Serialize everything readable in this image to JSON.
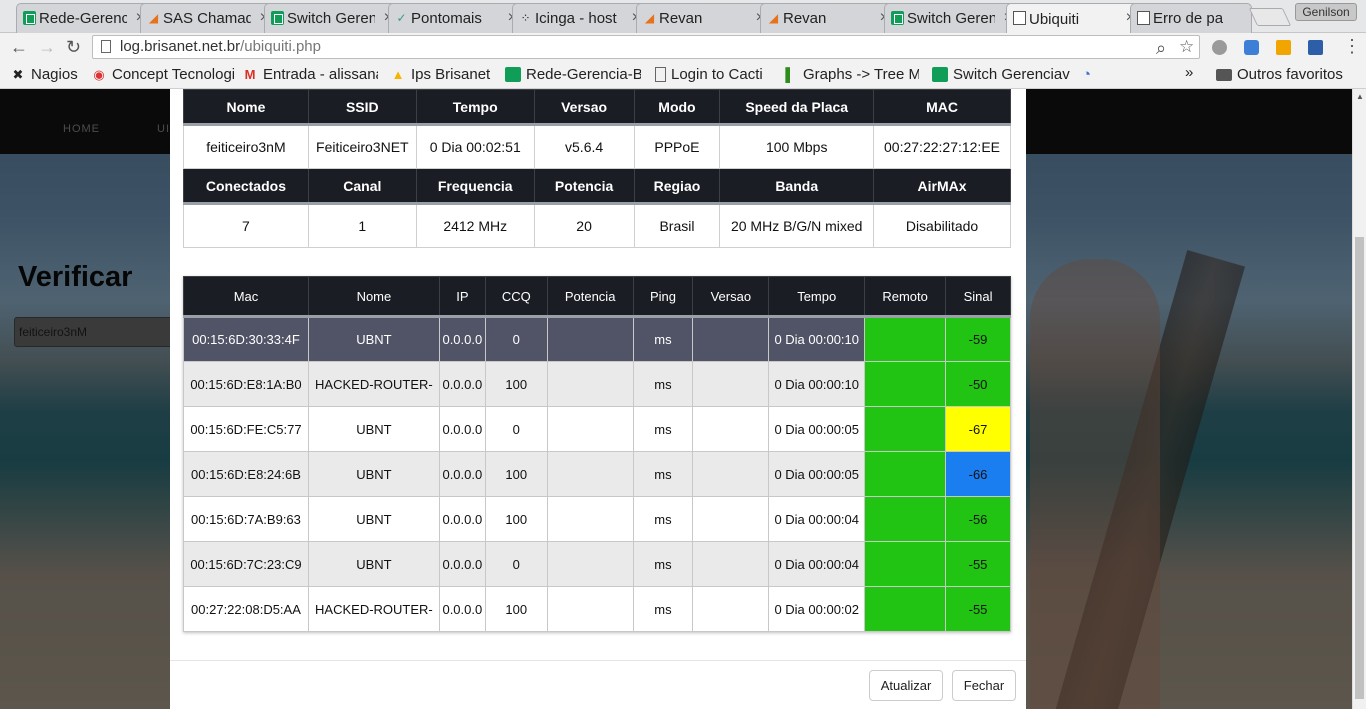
{
  "browser": {
    "tabs": [
      {
        "title": "Rede-Gerencia",
        "icon": "sheet-icon"
      },
      {
        "title": "SAS Chamados",
        "icon": "flame-icon"
      },
      {
        "title": "Switch Gerencia",
        "icon": "sheet-icon"
      },
      {
        "title": "Pontomais",
        "icon": "check-icon"
      },
      {
        "title": "Icinga - host",
        "icon": "icinga-icon"
      },
      {
        "title": "Revan",
        "icon": "flame-icon"
      },
      {
        "title": "Revan",
        "icon": "flame-icon"
      },
      {
        "title": "Switch Gerencia",
        "icon": "sheet-icon"
      },
      {
        "title": "Ubiquiti",
        "icon": "doc-icon"
      },
      {
        "title": "Erro de pagina",
        "icon": "doc-icon"
      }
    ],
    "tab_close": "×",
    "profile_name": "Genilson",
    "nav": {
      "back": "←",
      "forward": "→",
      "reload": "↻"
    },
    "url": {
      "host": "log.brisanet.net.br",
      "path": "/ubiquiti.php"
    },
    "omnibox_icons": {
      "zoom": "⌕",
      "star": "☆"
    },
    "menu": "⋮",
    "bookmarks": [
      {
        "label": "Nagios",
        "icon": "nagios-icon"
      },
      {
        "label": "Concept Tecnologia",
        "icon": "concept-icon"
      },
      {
        "label": "Entrada - alissana",
        "icon": "gmail-icon"
      },
      {
        "label": "Ips Brisanet",
        "icon": "drive-icon"
      },
      {
        "label": "Rede-Gerencia-Brisanet",
        "icon": "sheet-icon"
      },
      {
        "label": "Login to Cacti",
        "icon": "doc-icon"
      },
      {
        "label": "Graphs -> Tree Mode",
        "icon": "cacti-icon"
      },
      {
        "label": "Switch Gerenciavel",
        "icon": "sheet-icon"
      }
    ],
    "bookmarks_overflow": "»",
    "other_bookmarks": "Outros favoritos"
  },
  "page": {
    "nav_items": [
      "HOME",
      "UI"
    ],
    "heading": "Verificar",
    "search_value": "feiticeiro3nM"
  },
  "modal": {
    "info_headers_1": [
      "Nome",
      "SSID",
      "Tempo",
      "Versao",
      "Modo",
      "Speed da Placa",
      "MAC"
    ],
    "info_values_1": [
      "feiticeiro3nM",
      "Feiticeiro3NET",
      "0 Dia 00:02:51",
      "v5.6.4",
      "PPPoE",
      "100 Mbps",
      "00:27:22:27:12:EE"
    ],
    "info_headers_2": [
      "Conectados",
      "Canal",
      "Frequencia",
      "Potencia",
      "Regiao",
      "Banda",
      "AirMAx"
    ],
    "info_values_2": [
      "7",
      "1",
      "2412 MHz",
      "20",
      "Brasil",
      "20 MHz B/G/N mixed",
      "Disabilitado"
    ],
    "clients_headers": [
      "Mac",
      "Nome",
      "IP",
      "CCQ",
      "Potencia",
      "Ping",
      "Versao",
      "Tempo",
      "Remoto",
      "Sinal"
    ],
    "clients": [
      {
        "mac": "00:15:6D:30:33:4F",
        "nome": "UBNT",
        "ip": "0.0.0.0",
        "ccq": "0",
        "potencia": "",
        "ping": "ms",
        "versao": "",
        "tempo": "0 Dia 00:00:10",
        "remoto": "",
        "sinal": "-59",
        "sinal_color": "green"
      },
      {
        "mac": "00:15:6D:E8:1A:B0",
        "nome": "HACKED-ROUTER-",
        "ip": "0.0.0.0",
        "ccq": "100",
        "potencia": "",
        "ping": "ms",
        "versao": "",
        "tempo": "0 Dia 00:00:10",
        "remoto": "",
        "sinal": "-50",
        "sinal_color": "green"
      },
      {
        "mac": "00:15:6D:FE:C5:77",
        "nome": "UBNT",
        "ip": "0.0.0.0",
        "ccq": "0",
        "potencia": "",
        "ping": "ms",
        "versao": "",
        "tempo": "0 Dia 00:00:05",
        "remoto": "",
        "sinal": "-67",
        "sinal_color": "yellow"
      },
      {
        "mac": "00:15:6D:E8:24:6B",
        "nome": "UBNT",
        "ip": "0.0.0.0",
        "ccq": "100",
        "potencia": "",
        "ping": "ms",
        "versao": "",
        "tempo": "0 Dia 00:00:05",
        "remoto": "",
        "sinal": "-66",
        "sinal_color": "blue"
      },
      {
        "mac": "00:15:6D:7A:B9:63",
        "nome": "UBNT",
        "ip": "0.0.0.0",
        "ccq": "100",
        "potencia": "",
        "ping": "ms",
        "versao": "",
        "tempo": "0 Dia 00:00:04",
        "remoto": "",
        "sinal": "-56",
        "sinal_color": "green"
      },
      {
        "mac": "00:15:6D:7C:23:C9",
        "nome": "UBNT",
        "ip": "0.0.0.0",
        "ccq": "0",
        "potencia": "",
        "ping": "ms",
        "versao": "",
        "tempo": "0 Dia 00:00:04",
        "remoto": "",
        "sinal": "-55",
        "sinal_color": "green"
      },
      {
        "mac": "00:27:22:08:D5:AA",
        "nome": "HACKED-ROUTER-",
        "ip": "0.0.0.0",
        "ccq": "100",
        "potencia": "",
        "ping": "ms",
        "versao": "",
        "tempo": "0 Dia 00:00:02",
        "remoto": "",
        "sinal": "-55",
        "sinal_color": "green"
      }
    ],
    "selected_row": 0,
    "buttons": {
      "refresh": "Atualizar",
      "close": "Fechar"
    }
  },
  "colors": {
    "header_bg": "#1b1d24",
    "signal_green": "#21c412",
    "signal_yellow": "#ffff00",
    "signal_blue": "#1a7ef0",
    "selected_row": "#515366"
  }
}
